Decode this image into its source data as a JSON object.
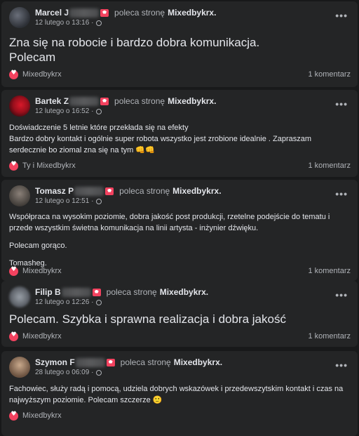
{
  "reviews": [
    {
      "name": "Marcel J",
      "recommends": "poleca stronę",
      "page": "Mixedbykrx.",
      "date": "12 lutego o 13:16 ·",
      "text_lines": [
        "Zna się na robocie i bardzo dobra komunikacja.",
        "Polecam"
      ],
      "reactions": "Mixedbykrx",
      "comments": "1 komentarz"
    },
    {
      "name": "Bartek Z",
      "recommends": "poleca stronę",
      "page": "Mixedbykrx.",
      "date": "12 lutego o 16:52 ·",
      "text_lines": [
        "Doświadczenie 5 letnie które przekłada się na efekty",
        "Bardzo dobry kontakt i ogólnie super robota wszystko jest zrobione idealnie . Zapraszam serdecznie bo ziomal zna się na tym"
      ],
      "emoji": "👊👊",
      "reactions": "Ty i Mixedbykrx",
      "comments": "1 komentarz"
    },
    {
      "name": "Tomasz P",
      "recommends": "poleca stronę",
      "page": "Mixedbykrx.",
      "date": "12 lutego o 12:51 ·",
      "paragraphs": [
        "Współpraca na wysokim poziomie, dobra jakość post produkcji, rzetelne podejście do tematu i przede wszystkim świetna komunikacja na linii artysta - inżynier dźwięku.",
        "Polecam gorąco.",
        "Tomasheg."
      ],
      "reactions": "Mixedbykrx",
      "comments": "1 komentarz"
    },
    {
      "name": "Filip B",
      "recommends": "poleca stronę",
      "page": "Mixedbykrx.",
      "date": "12 lutego o 12:26 ·",
      "text_lines": [
        "Polecam. Szybka i sprawna realizacja i dobra jakość"
      ],
      "reactions": "Mixedbykrx",
      "comments": "1 komentarz"
    },
    {
      "name": "Szymon F",
      "recommends": "poleca stronę",
      "page": "Mixedbykrx.",
      "date": "28 lutego o 06:09 ·",
      "text_lines": [
        "Fachowiec, służy radą i pomocą, udziela dobrych wskazówek i przedewszytskim kontakt i czas na najwyższym poziomie. Polecam szczerze"
      ],
      "emoji": "🙂",
      "reactions": "Mixedbykrx"
    }
  ],
  "icons": {
    "options": "more-options-icon",
    "reaction": "heart-reaction-icon",
    "audience": "globe-icon",
    "recommend": "recommend-badge-icon"
  },
  "colors": {
    "background": "#18191a",
    "card": "#242526",
    "accent": "#f3425f",
    "secondary_text": "#b0b3b8"
  }
}
